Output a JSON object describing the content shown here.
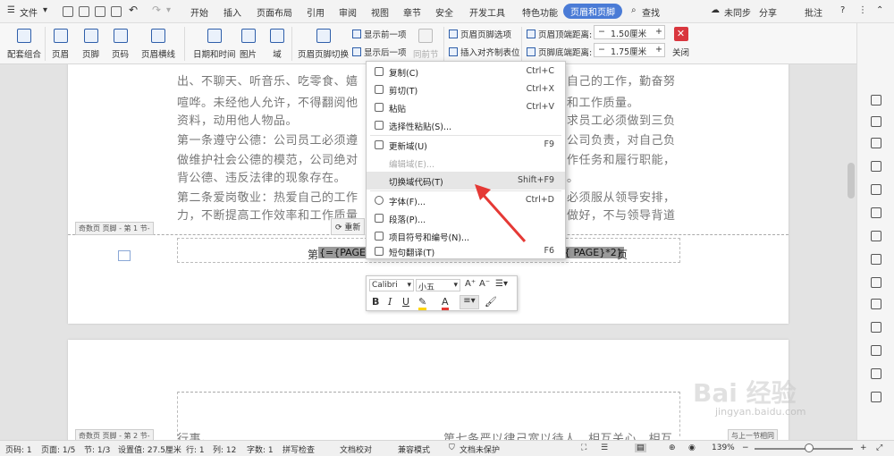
{
  "menubar": {
    "file_label": "文件",
    "tabs": [
      "开始",
      "插入",
      "页面布局",
      "引用",
      "审阅",
      "视图",
      "章节",
      "安全",
      "开发工具",
      "特色功能",
      "页眉和页脚"
    ],
    "active_tab": "页眉和页脚",
    "search_label": "查找",
    "sync_label": "未同步",
    "share_label": "分享",
    "comment_label": "批注"
  },
  "ribbon": {
    "buttons": [
      "配套组合",
      "页眉",
      "页脚",
      "页码",
      "页眉横线",
      "日期和时间",
      "图片",
      "域",
      "页眉页脚切换"
    ],
    "show_prev": "显示前一项",
    "show_next": "显示后一项",
    "same_prev": "同前节",
    "hf_options": "页眉页脚选项",
    "insert_tab": "插入对齐制表位",
    "top_dist_label": "页眉顶端距离:",
    "top_dist_value": "1.50厘米",
    "bottom_dist_label": "页脚底端距离:",
    "bottom_dist_value": "1.75厘米",
    "close_label": "关闭"
  },
  "document": {
    "lines": [
      "出、不聊天、听音乐、吃零食、嬉",
      "喧哗。未经他人允许，不得翻阅他",
      "资料，动用他人物品。",
      "第一条遵守公德：公司员工必须遵",
      "做维护社会公德的模范，公司绝对",
      "背公德、违反法律的现象存在。",
      "第二条爱岗敬业：热爱自己的工作",
      "力，不断提高工作效率和工作质量"
    ],
    "lines_right": [
      "自己的工作，勤奋努",
      "和工作质量。",
      "求员工必须做到三负",
      "公司负责，对自己负",
      "作任务和履行职能，",
      "。",
      "必须服从领导安排，",
      "做好，不与领导背道"
    ],
    "footer_label_1": "奇数页 页脚 - 第 1 节-",
    "footer_label_2": "奇数页 页脚 - 第 2 节-",
    "footer_prefix": "第",
    "footer_field_left": "{={PAGE}*",
    "footer_field_right": "{ PAGE}*2}",
    "footer_suffix": "页",
    "update_field_label": "重新",
    "page2_left": "行事。",
    "page2_right": "第七条严以律己宽以待人，相互关心，相互",
    "page2_tag": "与上一节相同"
  },
  "context_menu": [
    {
      "label": "复制(C)",
      "shortcut": "Ctrl+C",
      "disabled": false
    },
    {
      "label": "剪切(T)",
      "shortcut": "Ctrl+X",
      "disabled": false
    },
    {
      "label": "粘贴",
      "shortcut": "Ctrl+V",
      "disabled": false
    },
    {
      "label": "选择性粘贴(S)...",
      "shortcut": "",
      "disabled": false
    },
    {
      "label": "更新域(U)",
      "shortcut": "F9",
      "disabled": false
    },
    {
      "label": "编辑域(E)...",
      "shortcut": "",
      "disabled": true
    },
    {
      "label": "切换域代码(T)",
      "shortcut": "Shift+F9",
      "disabled": false
    },
    {
      "label": "字体(F)...",
      "shortcut": "Ctrl+D",
      "disabled": false
    },
    {
      "label": "段落(P)...",
      "shortcut": "",
      "disabled": false
    },
    {
      "label": "项目符号和编号(N)...",
      "shortcut": "",
      "disabled": false
    },
    {
      "label": "短句翻译(T)",
      "shortcut": "F6",
      "disabled": false
    }
  ],
  "mini_toolbar": {
    "font": "Calibri",
    "size": "小五"
  },
  "status": {
    "page": "页码: 1",
    "pages": "页面: 1/5",
    "section": "节: 1/3",
    "position": "设置值: 27.5厘米",
    "row": "行: 1",
    "col": "列: 12",
    "words": "字数: 1",
    "spell": "拼写检查",
    "proof": "文档校对",
    "compat": "兼容模式",
    "protect": "文档未保护",
    "zoom": "139%"
  },
  "watermark": {
    "brand": "Bai 经验",
    "url": "jingyan.baidu.com"
  },
  "colors": {
    "accent": "#4a7bd6",
    "arrow": "#e53935",
    "close": "#d9363e"
  }
}
